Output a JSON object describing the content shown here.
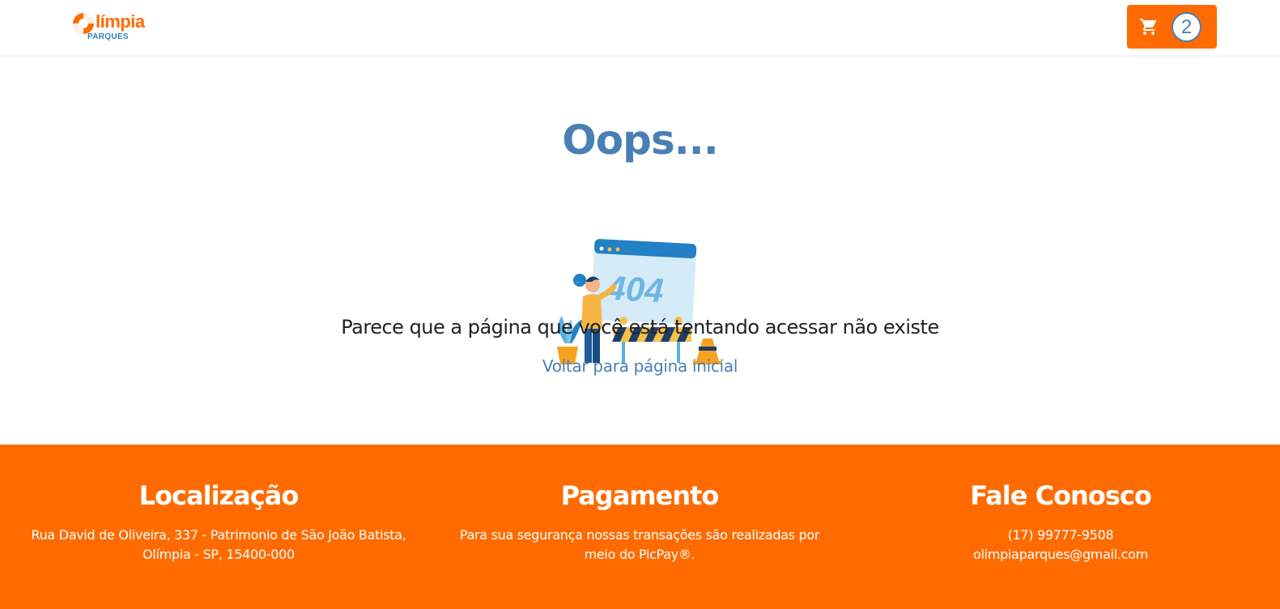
{
  "header": {
    "logo_text": "límpia",
    "logo_sub": "PARQUES",
    "cart_count": "2",
    "cart_icon": "cart-icon"
  },
  "main": {
    "title": "Oops...",
    "illustration_text": "404",
    "message": "Parece que a página que você está tentando acessar não existe",
    "back_link": "Voltar para página inicial"
  },
  "footer": {
    "location": {
      "title": "Localização",
      "line1": "Rua David de Oliveira, 337 - Patrimonio de São João Batista,",
      "line2": "Olímpia - SP, 15400-000"
    },
    "payment": {
      "title": "Pagamento",
      "line1": "Para sua segurança nossas transações são realizadas por",
      "line2": "meio do PicPay®."
    },
    "contact": {
      "title": "Fale Conosco",
      "phone": "(17) 99777-9508",
      "email": "olimpiaparques@gmail.com"
    }
  },
  "colors": {
    "brand_orange": "#ff6b00",
    "brand_blue": "#4a7fb5"
  }
}
